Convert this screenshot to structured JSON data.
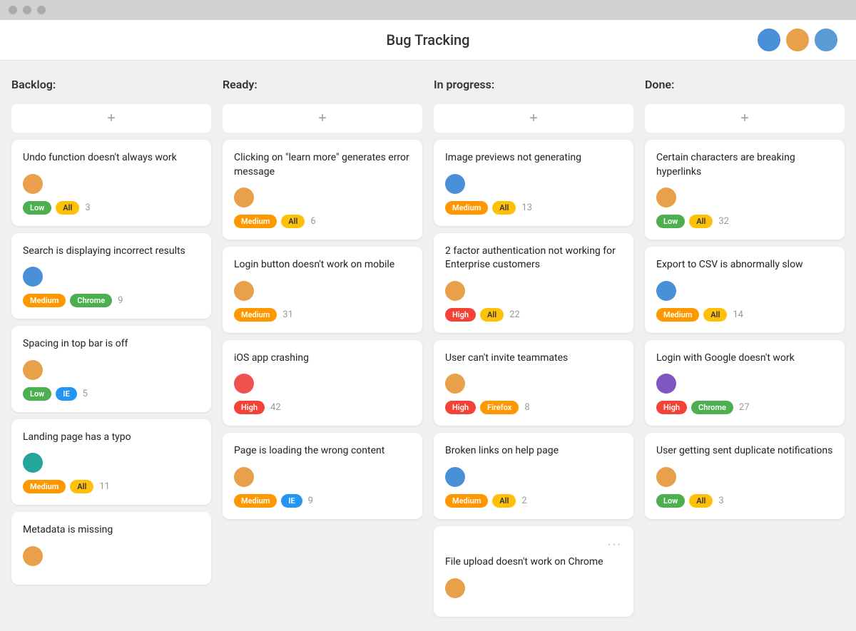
{
  "titleBar": {
    "buttons": [
      "close",
      "minimize",
      "maximize"
    ]
  },
  "header": {
    "title": "Bug Tracking",
    "avatars": [
      {
        "color": "av-blue",
        "label": "User 1"
      },
      {
        "color": "av-orange",
        "label": "User 2"
      },
      {
        "color": "av-cyan",
        "label": "User 3"
      }
    ]
  },
  "columns": [
    {
      "id": "backlog",
      "label": "Backlog:",
      "cards": [
        {
          "title": "Undo function doesn't always work",
          "avatarColor": "av-orange",
          "priority": "Low",
          "priorityClass": "badge-low",
          "tag": "All",
          "tagClass": "badge-all",
          "count": "3"
        },
        {
          "title": "Search is displaying incorrect results",
          "avatarColor": "av-blue",
          "priority": "Medium",
          "priorityClass": "badge-medium",
          "tag": "Chrome",
          "tagClass": "badge-chrome",
          "count": "9"
        },
        {
          "title": "Spacing in top bar is off",
          "avatarColor": "av-orange",
          "priority": "Low",
          "priorityClass": "badge-low",
          "tag": "IE",
          "tagClass": "badge-ie",
          "count": "5"
        },
        {
          "title": "Landing page has a typo",
          "avatarColor": "av-teal",
          "priority": "Medium",
          "priorityClass": "badge-medium",
          "tag": "All",
          "tagClass": "badge-all",
          "count": "11"
        },
        {
          "title": "Metadata is missing",
          "avatarColor": "av-orange",
          "priority": null,
          "tag": null,
          "count": null
        }
      ]
    },
    {
      "id": "ready",
      "label": "Ready:",
      "cards": [
        {
          "title": "Clicking on \"learn more\" generates error message",
          "avatarColor": "av-orange",
          "priority": "Medium",
          "priorityClass": "badge-medium",
          "tag": "All",
          "tagClass": "badge-all",
          "count": "6"
        },
        {
          "title": "Login button doesn't work on mobile",
          "avatarColor": "av-orange",
          "priority": "Medium",
          "priorityClass": "badge-medium",
          "tag": null,
          "tagClass": null,
          "count": "31"
        },
        {
          "title": "iOS app crashing",
          "avatarColor": "av-red",
          "priority": "High",
          "priorityClass": "badge-high",
          "tag": null,
          "tagClass": null,
          "count": "42"
        },
        {
          "title": "Page is loading the wrong content",
          "avatarColor": "av-orange",
          "priority": "Medium",
          "priorityClass": "badge-medium",
          "tag": "IE",
          "tagClass": "badge-ie",
          "count": "9"
        }
      ]
    },
    {
      "id": "inprogress",
      "label": "In progress:",
      "cards": [
        {
          "title": "Image previews not generating",
          "avatarColor": "av-blue",
          "priority": "Medium",
          "priorityClass": "badge-medium",
          "tag": "All",
          "tagClass": "badge-all",
          "count": "13"
        },
        {
          "title": "2 factor authentication not working for Enterprise customers",
          "avatarColor": "av-orange",
          "priority": "High",
          "priorityClass": "badge-high",
          "tag": "All",
          "tagClass": "badge-all",
          "count": "22"
        },
        {
          "title": "User can't invite teammates",
          "avatarColor": "av-orange",
          "priority": "High",
          "priorityClass": "badge-high",
          "tag": "Firefox",
          "tagClass": "badge-firefox",
          "count": "8"
        },
        {
          "title": "Broken links on help page",
          "avatarColor": "av-blue",
          "priority": "Medium",
          "priorityClass": "badge-medium",
          "tag": "All",
          "tagClass": "badge-all",
          "count": "2"
        },
        {
          "title": "File upload doesn't work on Chrome",
          "avatarColor": "av-orange",
          "priority": null,
          "tag": null,
          "count": null,
          "showDots": true
        }
      ]
    },
    {
      "id": "done",
      "label": "Done:",
      "cards": [
        {
          "title": "Certain characters are breaking hyperlinks",
          "avatarColor": "av-orange",
          "priority": "Low",
          "priorityClass": "badge-low",
          "tag": "All",
          "tagClass": "badge-all",
          "count": "32"
        },
        {
          "title": "Export to CSV is abnormally slow",
          "avatarColor": "av-blue",
          "priority": "Medium",
          "priorityClass": "badge-medium",
          "tag": "All",
          "tagClass": "badge-all",
          "count": "14"
        },
        {
          "title": "Login with Google doesn't work",
          "avatarColor": "av-purple",
          "priority": "High",
          "priorityClass": "badge-high",
          "tag": "Chrome",
          "tagClass": "badge-chrome",
          "count": "27"
        },
        {
          "title": "User getting sent duplicate notifications",
          "avatarColor": "av-orange",
          "priority": "Low",
          "priorityClass": "badge-low",
          "tag": "All",
          "tagClass": "badge-all",
          "count": "3"
        }
      ]
    }
  ],
  "addButton": "+",
  "dotsLabel": "···"
}
